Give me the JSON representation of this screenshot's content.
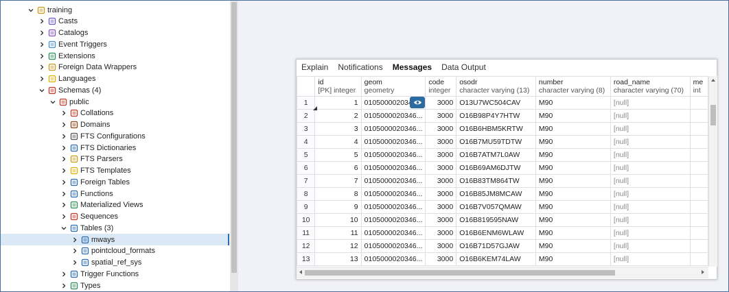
{
  "tree": [
    {
      "label": "training",
      "indent": 0,
      "expanded": true,
      "icon": "database-icon",
      "color": "#c79a1b"
    },
    {
      "label": "Casts",
      "indent": 1,
      "expanded": false,
      "icon": "casts-icon",
      "color": "#6a5acd"
    },
    {
      "label": "Catalogs",
      "indent": 1,
      "expanded": false,
      "icon": "catalogs-icon",
      "color": "#8a4fbf"
    },
    {
      "label": "Event Triggers",
      "indent": 1,
      "expanded": false,
      "icon": "event-triggers-icon",
      "color": "#4a90c2"
    },
    {
      "label": "Extensions",
      "indent": 1,
      "expanded": false,
      "icon": "extensions-icon",
      "color": "#2e8b57"
    },
    {
      "label": "Foreign Data Wrappers",
      "indent": 1,
      "expanded": false,
      "icon": "foreign-data-wrappers-icon",
      "color": "#c79a1b"
    },
    {
      "label": "Languages",
      "indent": 1,
      "expanded": false,
      "icon": "languages-icon",
      "color": "#e0b000"
    },
    {
      "label": "Schemas (4)",
      "indent": 1,
      "expanded": true,
      "icon": "schemas-icon",
      "color": "#c0392b"
    },
    {
      "label": "public",
      "indent": 2,
      "expanded": true,
      "icon": "schema-icon",
      "color": "#c0392b"
    },
    {
      "label": "Collations",
      "indent": 3,
      "expanded": false,
      "icon": "collations-icon",
      "color": "#c0392b"
    },
    {
      "label": "Domains",
      "indent": 3,
      "expanded": false,
      "icon": "domains-icon",
      "color": "#8b4513"
    },
    {
      "label": "FTS Configurations",
      "indent": 3,
      "expanded": false,
      "icon": "fts-configurations-icon",
      "color": "#555555"
    },
    {
      "label": "FTS Dictionaries",
      "indent": 3,
      "expanded": false,
      "icon": "fts-dictionaries-icon",
      "color": "#2b6cb0"
    },
    {
      "label": "FTS Parsers",
      "indent": 3,
      "expanded": false,
      "icon": "fts-parsers-icon",
      "color": "#c79a1b"
    },
    {
      "label": "FTS Templates",
      "indent": 3,
      "expanded": false,
      "icon": "fts-templates-icon",
      "color": "#e0b000"
    },
    {
      "label": "Foreign Tables",
      "indent": 3,
      "expanded": false,
      "icon": "foreign-tables-icon",
      "color": "#2b6cb0"
    },
    {
      "label": "Functions",
      "indent": 3,
      "expanded": false,
      "icon": "functions-icon",
      "color": "#2b6cb0"
    },
    {
      "label": "Materialized Views",
      "indent": 3,
      "expanded": false,
      "icon": "materialized-views-icon",
      "color": "#2e8b57"
    },
    {
      "label": "Sequences",
      "indent": 3,
      "expanded": false,
      "icon": "sequences-icon",
      "color": "#c0392b"
    },
    {
      "label": "Tables (3)",
      "indent": 3,
      "expanded": true,
      "icon": "tables-icon",
      "color": "#2b6cb0"
    },
    {
      "label": "mways",
      "indent": 4,
      "expanded": false,
      "icon": "table-icon",
      "color": "#2b6cb0",
      "selected": true
    },
    {
      "label": "pointcloud_formats",
      "indent": 4,
      "expanded": false,
      "icon": "table-icon",
      "color": "#2b6cb0"
    },
    {
      "label": "spatial_ref_sys",
      "indent": 4,
      "expanded": false,
      "icon": "table-icon",
      "color": "#2b6cb0"
    },
    {
      "label": "Trigger Functions",
      "indent": 3,
      "expanded": false,
      "icon": "trigger-functions-icon",
      "color": "#2b6cb0"
    },
    {
      "label": "Types",
      "indent": 3,
      "expanded": false,
      "icon": "types-icon",
      "color": "#2e8b57"
    }
  ],
  "results": {
    "tabs": [
      {
        "label": "Explain",
        "active": false
      },
      {
        "label": "Notifications",
        "active": false
      },
      {
        "label": "Messages",
        "active": true
      },
      {
        "label": "Data Output",
        "active": false
      }
    ],
    "columns": [
      {
        "name": "id",
        "type": "[PK] integer"
      },
      {
        "name": "geom",
        "type": "geometry"
      },
      {
        "name": "code",
        "type": "integer"
      },
      {
        "name": "osodr",
        "type": "character varying (13)"
      },
      {
        "name": "number",
        "type": "character varying (8)"
      },
      {
        "name": "road_name",
        "type": "character varying (70)"
      },
      {
        "name": "me",
        "type": "int"
      }
    ],
    "rows": [
      {
        "n": "1",
        "id": "1",
        "geom": "0105000020346...",
        "code": "3000",
        "osodr": "O13U7WC504CAV",
        "number": "M90",
        "road_name": "[null]"
      },
      {
        "n": "2",
        "id": "2",
        "geom": "0105000020346...",
        "code": "3000",
        "osodr": "O16B98P4Y7HTW",
        "number": "M90",
        "road_name": "[null]"
      },
      {
        "n": "3",
        "id": "3",
        "geom": "0105000020346...",
        "code": "3000",
        "osodr": "O16B6HBM5KRTW",
        "number": "M90",
        "road_name": "[null]"
      },
      {
        "n": "4",
        "id": "4",
        "geom": "0105000020346...",
        "code": "3000",
        "osodr": "O16B7MU59TDTW",
        "number": "M90",
        "road_name": "[null]"
      },
      {
        "n": "5",
        "id": "5",
        "geom": "0105000020346...",
        "code": "3000",
        "osodr": "O16B7ATM7L0AW",
        "number": "M90",
        "road_name": "[null]"
      },
      {
        "n": "6",
        "id": "6",
        "geom": "0105000020346...",
        "code": "3000",
        "osodr": "O16B69AM6DJTW",
        "number": "M90",
        "road_name": "[null]"
      },
      {
        "n": "7",
        "id": "7",
        "geom": "0105000020346...",
        "code": "3000",
        "osodr": "O16B83TM864TW",
        "number": "M90",
        "road_name": "[null]"
      },
      {
        "n": "8",
        "id": "8",
        "geom": "0105000020346...",
        "code": "3000",
        "osodr": "O16B85JM8MCAW",
        "number": "M90",
        "road_name": "[null]"
      },
      {
        "n": "9",
        "id": "9",
        "geom": "0105000020346...",
        "code": "3000",
        "osodr": "O16B7V057QMAW",
        "number": "M90",
        "road_name": "[null]"
      },
      {
        "n": "10",
        "id": "10",
        "geom": "0105000020346...",
        "code": "3000",
        "osodr": "O16B819595NAW",
        "number": "M90",
        "road_name": "[null]"
      },
      {
        "n": "11",
        "id": "11",
        "geom": "0105000020346...",
        "code": "3000",
        "osodr": "O16B6ENM6WLAW",
        "number": "M90",
        "road_name": "[null]"
      },
      {
        "n": "12",
        "id": "12",
        "geom": "0105000020346...",
        "code": "3000",
        "osodr": "O16B71D57GJAW",
        "number": "M90",
        "road_name": "[null]"
      },
      {
        "n": "13",
        "id": "13",
        "geom": "0105000020346...",
        "code": "3000",
        "osodr": "O16B6KEM74LAW",
        "number": "M90",
        "road_name": "[null]"
      }
    ]
  }
}
